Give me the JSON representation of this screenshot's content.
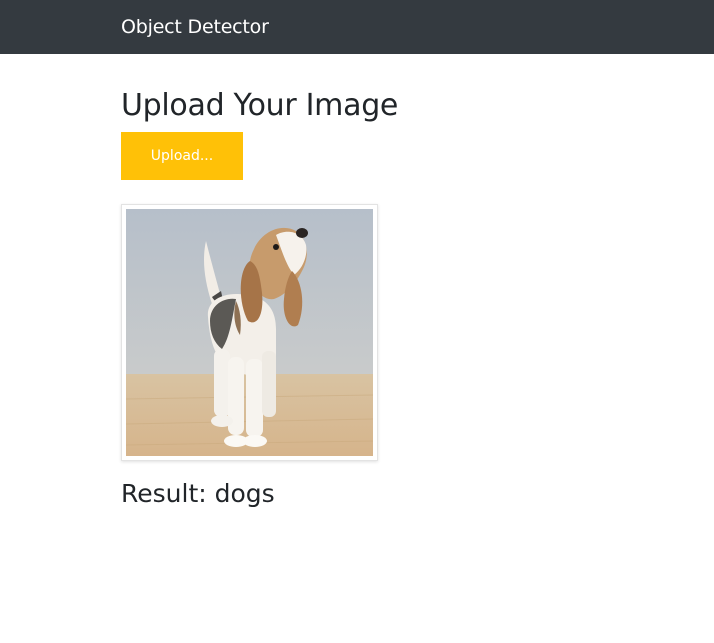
{
  "navbar": {
    "brand": "Object Detector",
    "background": "#343a40"
  },
  "main": {
    "title": "Upload Your Image",
    "upload_button_label": "Upload...",
    "upload_button_color": "#ffc107",
    "image_icon": "beagle-puppy-photo",
    "result_text": "Result: dogs"
  }
}
